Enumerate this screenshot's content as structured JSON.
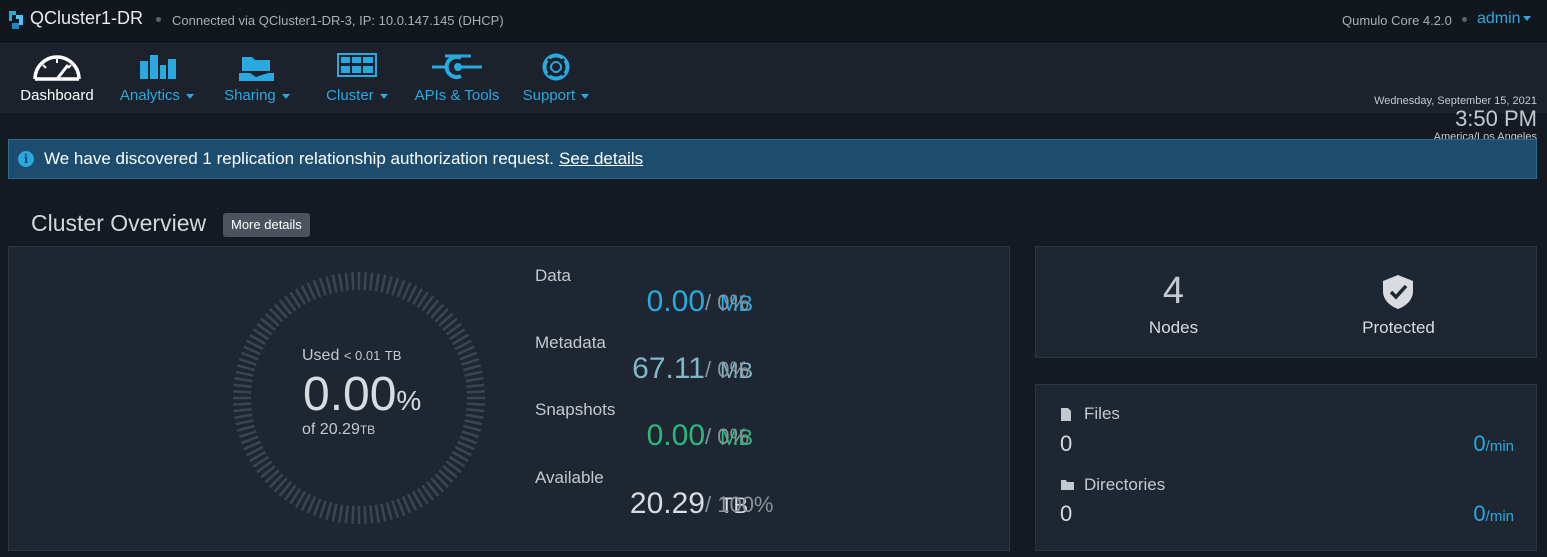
{
  "header": {
    "cluster_name": "QCluster1-DR",
    "connection": "Connected via QCluster1-DR-3, IP: 10.0.147.145 (DHCP)",
    "version": "Qumulo Core 4.2.0",
    "user": "admin"
  },
  "nav": {
    "items": [
      {
        "label": "Dashboard",
        "icon": "gauge-icon"
      },
      {
        "label": "Analytics",
        "icon": "bar-chart-icon"
      },
      {
        "label": "Sharing",
        "icon": "folder-share-icon"
      },
      {
        "label": "Cluster",
        "icon": "cluster-grid-icon"
      },
      {
        "label": "APIs & Tools",
        "icon": "api-icon"
      },
      {
        "label": "Support",
        "icon": "lifebuoy-icon"
      }
    ]
  },
  "datetime": {
    "date": "Wednesday, September 15, 2021",
    "time": "3:50 PM",
    "timezone": "America/Los Angeles"
  },
  "alert": {
    "text": "We have discovered 1 replication relationship authorization request.",
    "link": "See details"
  },
  "overview": {
    "title": "Cluster Overview",
    "more_details": "More details",
    "gauge": {
      "used_prefix": "Used",
      "used_value": "< 0.01",
      "used_unit": "TB",
      "percent": "0.00",
      "percent_sym": "%",
      "of_prefix": "of",
      "of_value": "20.29",
      "of_unit": "TB"
    },
    "stats": [
      {
        "label": "Data",
        "value": "0.00",
        "unit": "MB",
        "pct": "/ 0%",
        "color": "#2aa8e0"
      },
      {
        "label": "Metadata",
        "value": "67.11",
        "unit": "MB",
        "pct": "/ 0%",
        "color": "#7fb6c9"
      },
      {
        "label": "Snapshots",
        "value": "0.00",
        "unit": "MB",
        "pct": "/ 0%",
        "color": "#2ab87a"
      },
      {
        "label": "Available",
        "value": "20.29",
        "unit": "TB",
        "pct": "/ 100%",
        "color": "#d8dce1"
      }
    ]
  },
  "nodes": {
    "count": "4",
    "label": "Nodes",
    "status": "Protected"
  },
  "files": {
    "files_label": "Files",
    "files_count": "0",
    "files_rate": "0",
    "files_rate_unit": "/min",
    "dirs_label": "Directories",
    "dirs_count": "0",
    "dirs_rate": "0",
    "dirs_rate_unit": "/min"
  }
}
